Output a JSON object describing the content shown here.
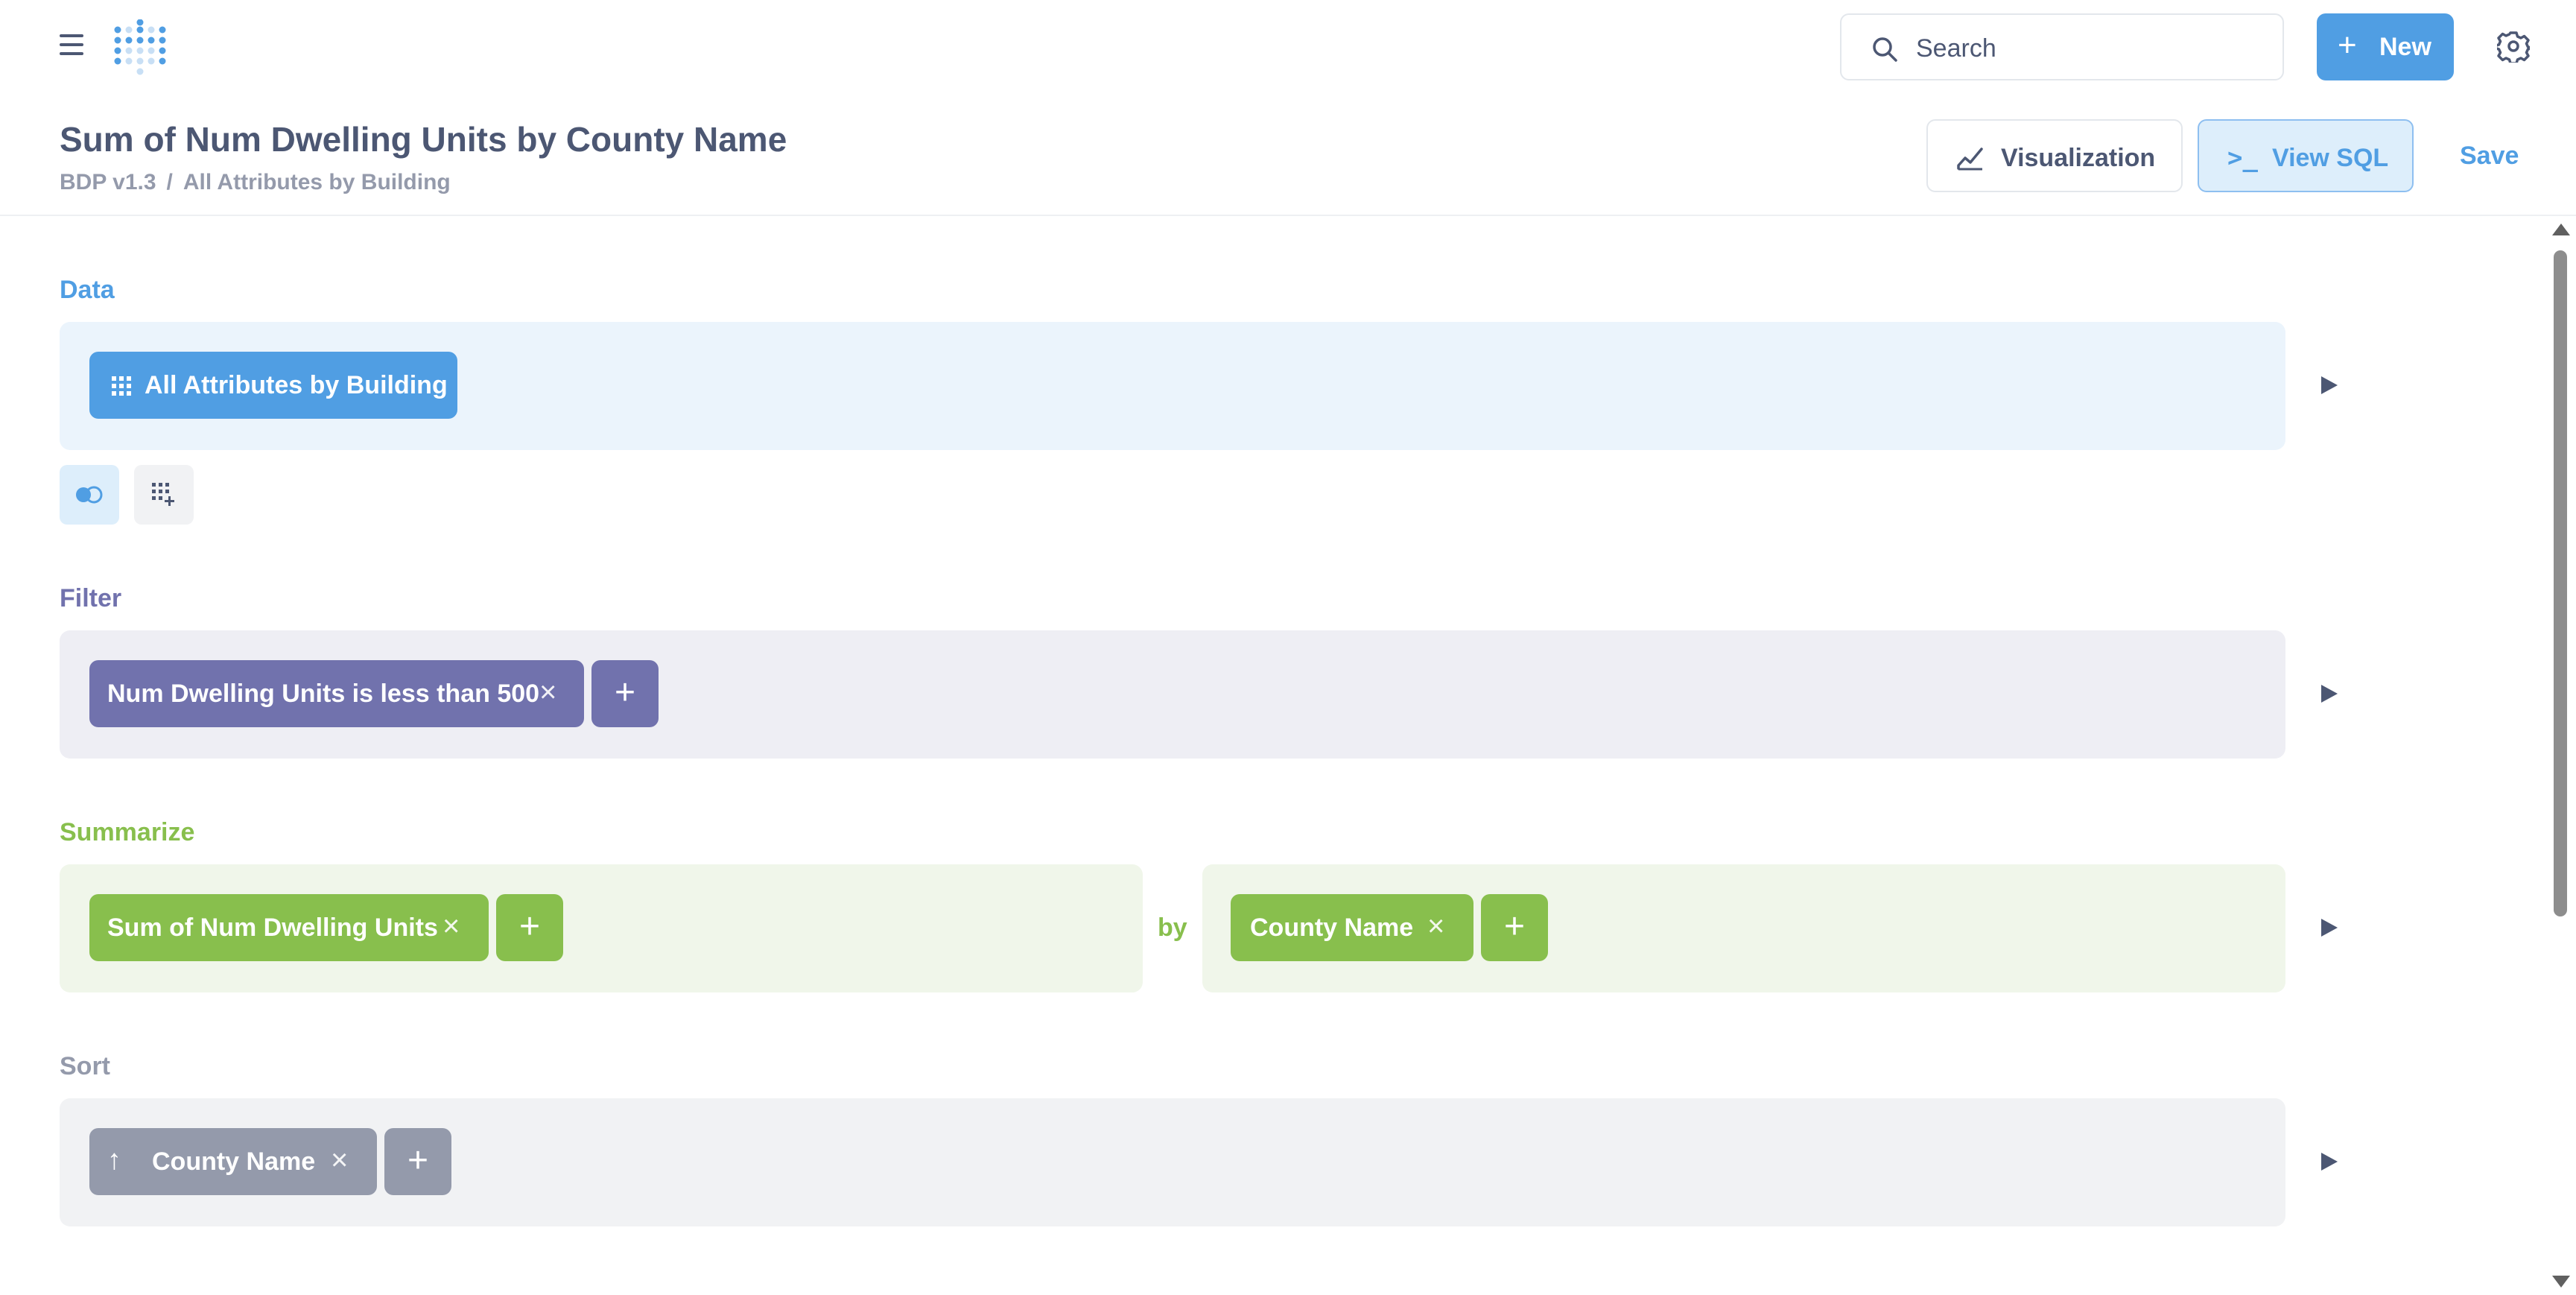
{
  "nav": {
    "search_label": "Search",
    "new_label": "New",
    "new_icon": "plus-icon",
    "brand_color": "#509ee3"
  },
  "header": {
    "title": "Sum of Num Dwelling Units by County Name",
    "breadcrumb": [
      "BDP v1.3",
      "/",
      "All Attributes by Building"
    ],
    "visualization_label": "Visualization",
    "view_sql_label": "View SQL",
    "view_sql_icon": ">_",
    "save_label": "Save"
  },
  "data_step": {
    "label": "Data",
    "table_name": "All Attributes by Building",
    "color": "#509ee3",
    "bg": "#ebf4fc"
  },
  "filter_step": {
    "label": "Filter",
    "filters": [
      "Num Dwelling Units is less than 500"
    ],
    "color": "#7172ad",
    "bg": "#eeeef4"
  },
  "summarize_step": {
    "label": "Summarize",
    "metrics": [
      "Sum of Num Dwelling Units"
    ],
    "by_label": "by",
    "breakouts": [
      "County Name"
    ],
    "color": "#88bf4d",
    "bg": "#f0f6ea"
  },
  "sort_step": {
    "label": "Sort",
    "sorts": [
      {
        "field": "County Name",
        "direction": "ascending"
      }
    ],
    "color": "#949aab",
    "bg": "#f1f2f4"
  },
  "icons": {
    "close": "×",
    "add": "+",
    "ascending": "↑"
  }
}
